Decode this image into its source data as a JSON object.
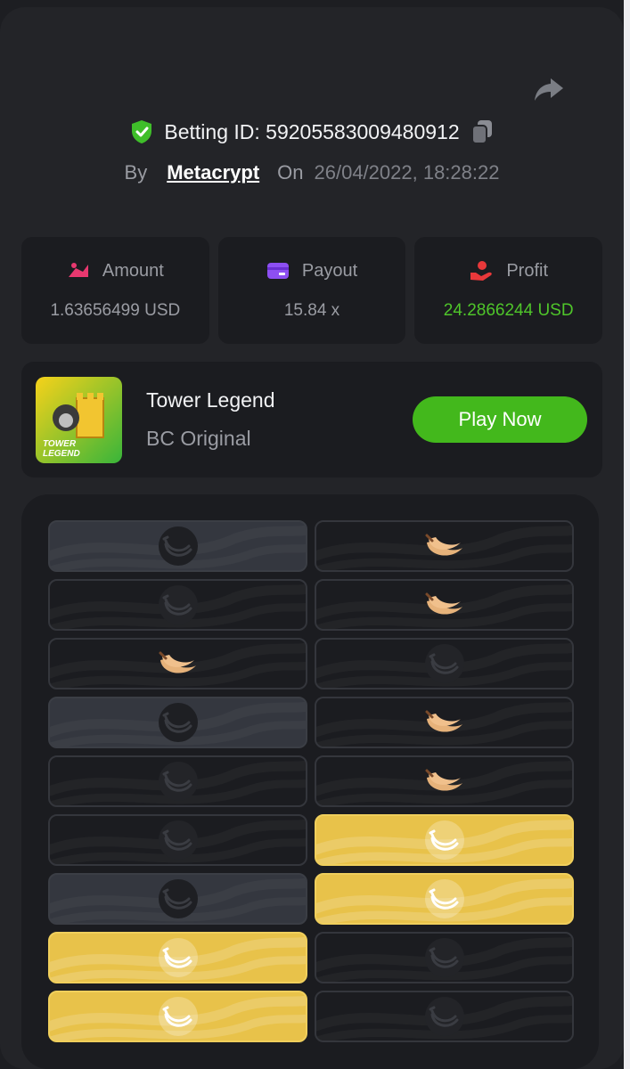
{
  "header": {
    "betting_id": "Betting ID: 59205583009480912",
    "by_label": "By",
    "author": "Metacrypt",
    "on_label": "On",
    "date": "26/04/2022, 18:28:22"
  },
  "stats": {
    "amount": {
      "label": "Amount",
      "value": "1.63656499 USD"
    },
    "payout": {
      "label": "Payout",
      "value": "15.84 x"
    },
    "profit": {
      "label": "Profit",
      "value": "24.2866244 USD"
    }
  },
  "game": {
    "title": "Tower Legend",
    "subtitle": "BC Original",
    "play_label": "Play Now",
    "thumb_text_1": "TOWER",
    "thumb_text_2": "LEGEND"
  },
  "colors": {
    "accent_green": "#43b81c",
    "profit_green": "#4fc52a",
    "gold_tile": "#e8c24a",
    "banana": "#e6b27a"
  },
  "tower": {
    "rows": [
      {
        "left": "grey",
        "right": "banana"
      },
      {
        "left": "dark",
        "right": "banana"
      },
      {
        "left": "banana",
        "right": "dark"
      },
      {
        "left": "grey",
        "right": "banana"
      },
      {
        "left": "dark",
        "right": "banana"
      },
      {
        "left": "dark",
        "right": "gold"
      },
      {
        "left": "grey",
        "right": "gold"
      },
      {
        "left": "gold",
        "right": "dark"
      },
      {
        "left": "gold",
        "right": "dark"
      }
    ]
  }
}
